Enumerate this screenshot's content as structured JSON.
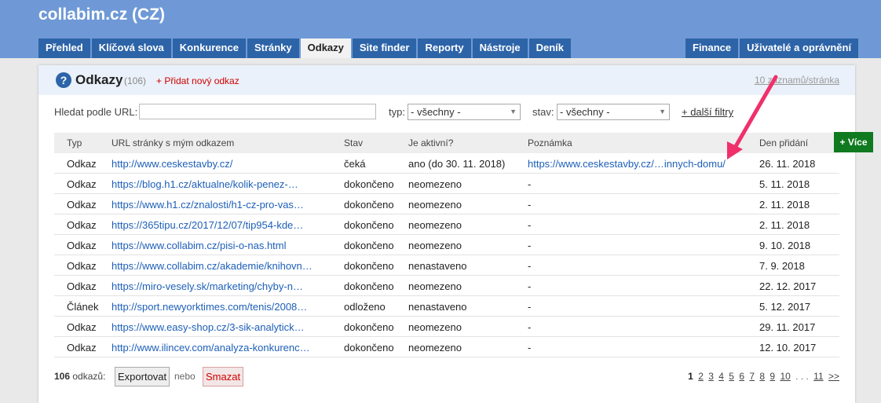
{
  "brand": "collabim.cz (CZ)",
  "nav": {
    "left": [
      "Přehled",
      "Klíčová slova",
      "Konkurence",
      "Stránky",
      "Odkazy",
      "Site finder",
      "Reporty",
      "Nástroje",
      "Deník"
    ],
    "right": [
      "Finance",
      "Uživatelé a oprávnění"
    ],
    "active": "Odkazy"
  },
  "panel": {
    "help_icon": "?",
    "title": "Odkazy",
    "count": "(106)",
    "add_link": "+ Přidat nový odkaz",
    "per_page": "10 záznamů/stránka"
  },
  "filters": {
    "search_label": "Hledat podle URL:",
    "search_value": "",
    "type_label": "typ:",
    "type_value": "- všechny -",
    "status_label": "stav:",
    "status_value": "- všechny -",
    "more_filters": "+ další filtry"
  },
  "table": {
    "headers": {
      "typ": "Typ",
      "url": "URL stránky s mým odkazem",
      "stav": "Stav",
      "aktivni": "Je aktivní?",
      "poznamka": "Poznámka",
      "den": "Den přidání"
    },
    "rows": [
      {
        "typ": "Odkaz",
        "url": "http://www.ceskestavby.cz/",
        "stav": "čeká",
        "aktivni": "ano (do 30. 11. 2018)",
        "poznamka": "https://www.ceskestavby.cz/…innych-domu/",
        "den": "26. 11. 2018"
      },
      {
        "typ": "Odkaz",
        "url": "https://blog.h1.cz/aktualne/kolik-penez-…",
        "stav": "dokončeno",
        "aktivni": "neomezeno",
        "poznamka": "-",
        "den": "5. 11. 2018"
      },
      {
        "typ": "Odkaz",
        "url": "https://www.h1.cz/znalosti/h1-cz-pro-vas…",
        "stav": "dokončeno",
        "aktivni": "neomezeno",
        "poznamka": "-",
        "den": "2. 11. 2018"
      },
      {
        "typ": "Odkaz",
        "url": "https://365tipu.cz/2017/12/07/tip954-kde…",
        "stav": "dokončeno",
        "aktivni": "neomezeno",
        "poznamka": "-",
        "den": "2. 11. 2018"
      },
      {
        "typ": "Odkaz",
        "url": "https://www.collabim.cz/pisi-o-nas.html",
        "stav": "dokončeno",
        "aktivni": "neomezeno",
        "poznamka": "-",
        "den": "9. 10. 2018"
      },
      {
        "typ": "Odkaz",
        "url": "https://www.collabim.cz/akademie/knihovn…",
        "stav": "dokončeno",
        "aktivni": "nenastaveno",
        "poznamka": "-",
        "den": "7. 9. 2018"
      },
      {
        "typ": "Odkaz",
        "url": "https://miro-vesely.sk/marketing/chyby-n…",
        "stav": "dokončeno",
        "aktivni": "neomezeno",
        "poznamka": "-",
        "den": "22. 12. 2017"
      },
      {
        "typ": "Článek",
        "url": "http://sport.newyorktimes.com/tenis/2008…",
        "stav": "odloženo",
        "aktivni": "nenastaveno",
        "poznamka": "-",
        "den": "5. 12. 2017"
      },
      {
        "typ": "Odkaz",
        "url": "https://www.easy-shop.cz/3-sik-analytick…",
        "stav": "dokončeno",
        "aktivni": "neomezeno",
        "poznamka": "-",
        "den": "29. 11. 2017"
      },
      {
        "typ": "Odkaz",
        "url": "http://www.ilincev.com/analyza-konkurenc…",
        "stav": "dokončeno",
        "aktivni": "neomezeno",
        "poznamka": "-",
        "den": "12. 10. 2017"
      }
    ]
  },
  "more_button": "+ Více",
  "footer": {
    "count_number": "106",
    "count_label": "odkazů:",
    "export_button": "Exportovat",
    "or_text": "nebo",
    "delete_button": "Smazat",
    "pages": [
      "1",
      "2",
      "3",
      "4",
      "5",
      "6",
      "7",
      "8",
      "9",
      "10"
    ],
    "current_page": "1",
    "ellipsis": ". . .",
    "last_page": "11",
    "next": ">>"
  },
  "colors": {
    "topbar": "#6f99d6",
    "tab": "#2d64a8",
    "link": "#1d5fb8",
    "add_link": "#d20000",
    "more_button": "#0f7a1f",
    "annotation_arrow": "#f0306a"
  }
}
